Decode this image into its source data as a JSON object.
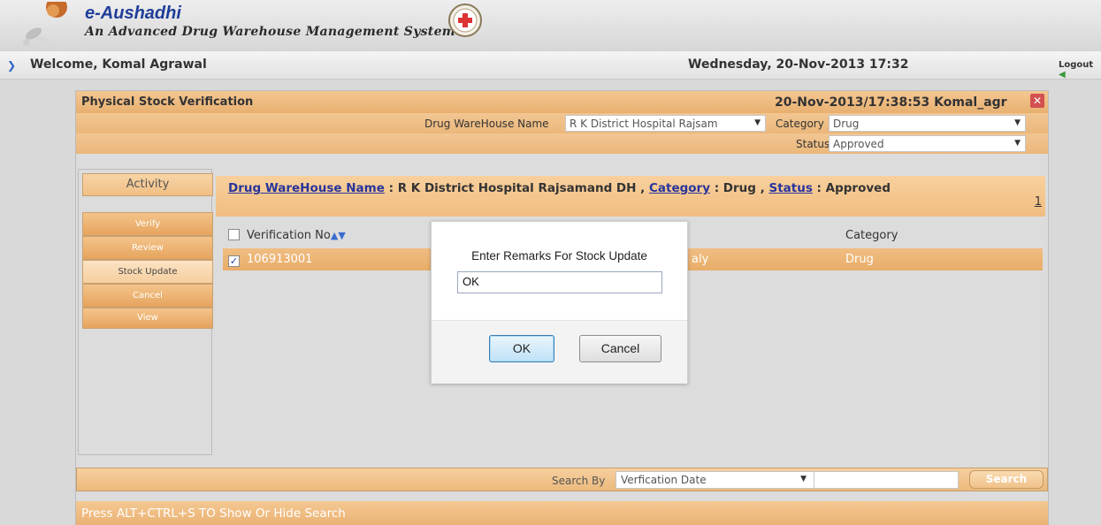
{
  "header": {
    "app_title": "e-Aushadhi",
    "app_subtitle": "An Advanced Drug Warehouse Management System"
  },
  "welcome_bar": {
    "welcome": "Welcome, Komal Agrawal",
    "datetime": "Wednesday, 20-Nov-2013 17:32",
    "logout_label": "Logout"
  },
  "panel": {
    "title": "Physical Stock Verification",
    "stamp": "20-Nov-2013/17:38:53 Komal_agr",
    "filters": {
      "warehouse_label": "Drug WareHouse Name",
      "warehouse_value": "R K District Hospital Rajsam",
      "category_label": "Category",
      "category_value": "Drug",
      "status_label": "Status",
      "status_value": "Approved"
    }
  },
  "activity": {
    "heading": "Activity",
    "items": [
      "Verify",
      "Review",
      "Stock Update",
      "Cancel",
      "View"
    ],
    "active_index": 2
  },
  "content": {
    "crumb": {
      "warehouse_link": "Drug WareHouse Name",
      "warehouse_value": " : R K District Hospital Rajsamand DH , ",
      "category_link": "Category",
      "category_value": " : Drug , ",
      "status_link": "Status",
      "status_value": " : Approved"
    },
    "page": "1",
    "table": {
      "columns": [
        "Verification No",
        "Category"
      ],
      "rows": [
        {
          "checked": true,
          "verification_no": "106913001",
          "partial": "aly",
          "category": "Drug"
        }
      ]
    }
  },
  "search": {
    "label": "Search By",
    "select_value": "Verfication Date",
    "input_value": "",
    "button_label": "Search"
  },
  "hint": "Press ALT+CTRL+S TO Show Or Hide Search",
  "modal": {
    "message": "Enter Remarks For Stock Update",
    "input_value": "OK",
    "ok_label": "OK",
    "cancel_label": "Cancel"
  },
  "icons": {
    "welcome_arrow": "chevron-right-icon",
    "close": "close-icon",
    "sort": "sort-icon",
    "dropdown": "caret-down-icon",
    "logout": "logout-icon"
  },
  "colors": {
    "link": "#27349c",
    "accent_orange": "#f0bd80",
    "brand_blue": "#1f3d99"
  }
}
